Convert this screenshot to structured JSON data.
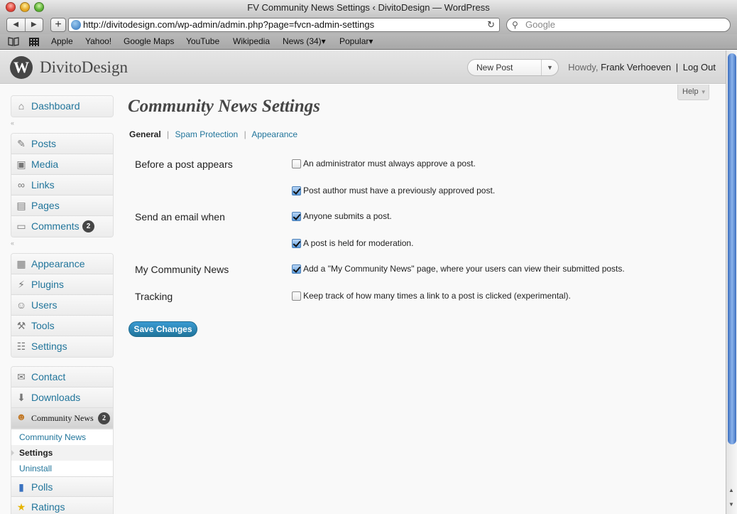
{
  "window": {
    "title": "FV Community News Settings ‹ DivitoDesign — WordPress"
  },
  "browser": {
    "url": "http://divitodesign.com/wp-admin/admin.php?page=fvcn-admin-settings",
    "search_placeholder": "Google",
    "bookmarks": [
      "Apple",
      "Yahoo!",
      "Google Maps",
      "YouTube",
      "Wikipedia",
      "News (34)▾",
      "Popular▾"
    ]
  },
  "header": {
    "site_name": "DivitoDesign",
    "new_post": "New Post",
    "howdy": "Howdy,",
    "user": "Frank Verhoeven",
    "separator": "|",
    "logout": "Log Out",
    "help": "Help"
  },
  "menu": {
    "group1": [
      {
        "label": "Dashboard",
        "icon": "dashboard-icon"
      }
    ],
    "group2": [
      {
        "label": "Posts",
        "icon": "pin-icon"
      },
      {
        "label": "Media",
        "icon": "media-icon"
      },
      {
        "label": "Links",
        "icon": "links-icon"
      },
      {
        "label": "Pages",
        "icon": "pages-icon"
      },
      {
        "label": "Comments",
        "icon": "comments-icon",
        "badge": "2"
      }
    ],
    "group3": [
      {
        "label": "Appearance",
        "icon": "appearance-icon"
      },
      {
        "label": "Plugins",
        "icon": "plugins-icon"
      },
      {
        "label": "Users",
        "icon": "users-icon"
      },
      {
        "label": "Tools",
        "icon": "tools-icon"
      },
      {
        "label": "Settings",
        "icon": "settings-icon"
      }
    ],
    "group4": [
      {
        "label": "Contact",
        "icon": "contact-icon"
      },
      {
        "label": "Downloads",
        "icon": "downloads-icon"
      },
      {
        "label": "Community News",
        "icon": "community-icon",
        "badge": "2"
      }
    ],
    "community_sub": [
      "Community News",
      "Settings",
      "Uninstall"
    ],
    "group5": [
      {
        "label": "Polls",
        "icon": "polls-icon"
      },
      {
        "label": "Ratings",
        "icon": "ratings-icon"
      }
    ]
  },
  "page": {
    "title": "Community News Settings",
    "tabs": [
      "General",
      "Spam Protection",
      "Appearance"
    ],
    "rows": {
      "before_post": "Before a post appears",
      "send_email": "Send an email when",
      "my_community": "My Community News",
      "tracking": "Tracking"
    },
    "options": [
      {
        "label": "An administrator must always approve a post.",
        "checked": false
      },
      {
        "label": "Post author must have a previously approved post.",
        "checked": true
      },
      {
        "label": "Anyone submits a post.",
        "checked": true
      },
      {
        "label": "A post is held for moderation.",
        "checked": true
      },
      {
        "label": "Add a \"My Community News\" page, where your users can view their submitted posts.",
        "checked": true
      },
      {
        "label": "Keep track of how many times a link to a post is clicked (experimental).",
        "checked": false
      }
    ],
    "save_button": "Save Changes"
  },
  "colors": {
    "link": "#21759b",
    "button": "#21759b",
    "scrollbar": "#3d6fbf"
  }
}
